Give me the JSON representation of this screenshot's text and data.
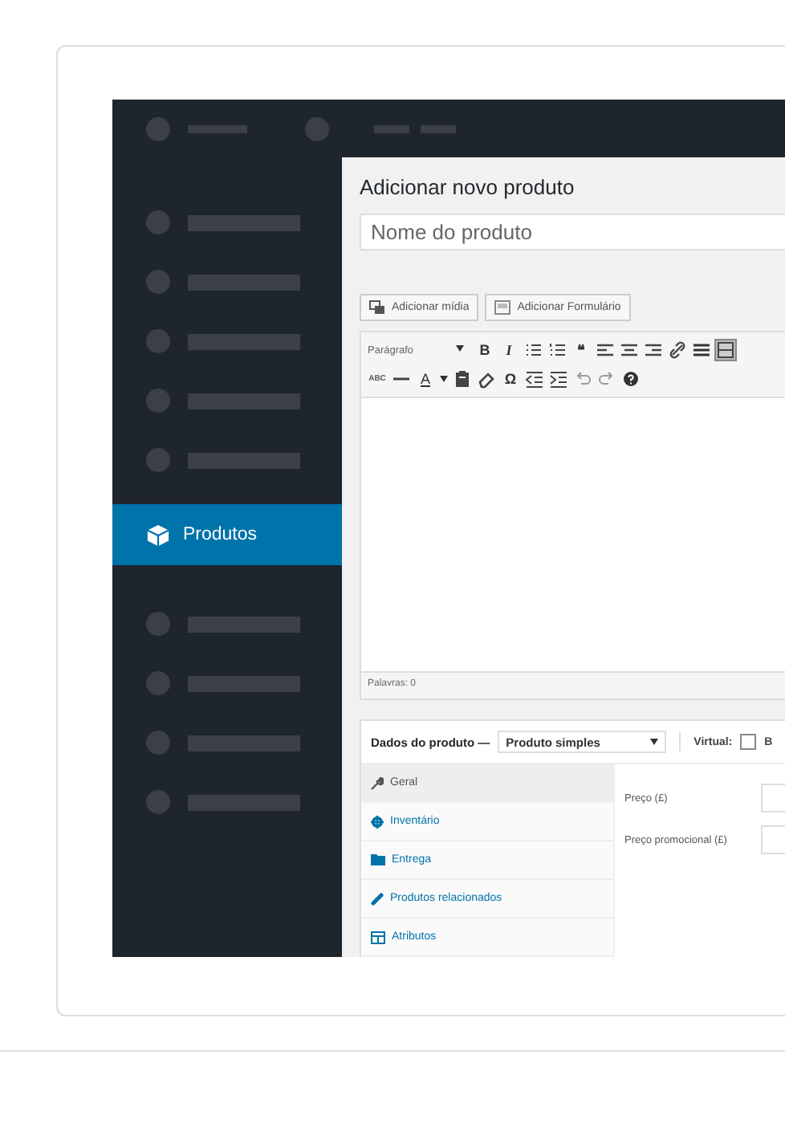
{
  "sidebar": {
    "items": [
      {
        "kind": "placeholder",
        "selected": false
      },
      {
        "kind": "placeholder",
        "selected": false
      },
      {
        "kind": "placeholder",
        "selected": false
      },
      {
        "kind": "placeholder",
        "selected": false
      },
      {
        "kind": "placeholder",
        "selected": false
      },
      {
        "kind": "link",
        "label": "Produtos",
        "selected": true
      },
      {
        "kind": "placeholder",
        "selected": false
      },
      {
        "kind": "placeholder",
        "selected": false
      },
      {
        "kind": "placeholder",
        "selected": false
      },
      {
        "kind": "placeholder",
        "selected": false
      }
    ]
  },
  "page": {
    "title": "Adicionar novo produto",
    "name_field": {
      "placeholder": "Nome do produto"
    }
  },
  "media_buttons": [
    {
      "kind": "media",
      "label": "Adicionar mídia"
    },
    {
      "kind": "form",
      "label": "Adicionar Formulário"
    }
  ],
  "editor": {
    "format_select": "Parágrafo",
    "toolbar_row_1": [
      {
        "kind": "bold",
        "text": "B",
        "selected": false
      },
      {
        "kind": "italic",
        "text": "I",
        "selected": false
      },
      {
        "kind": "bullet-list",
        "selected": false
      },
      {
        "kind": "numbered-list",
        "selected": false
      },
      {
        "kind": "quote",
        "text": "❝",
        "selected": false
      },
      {
        "kind": "align-left",
        "selected": false
      },
      {
        "kind": "align-center",
        "selected": false
      },
      {
        "kind": "align-right",
        "selected": false
      },
      {
        "kind": "link",
        "selected": false
      },
      {
        "kind": "more",
        "selected": false
      },
      {
        "kind": "toolbar",
        "selected": true
      }
    ],
    "toolbar_row_2": [
      {
        "kind": "strikethrough",
        "text": "ABC"
      },
      {
        "kind": "rule"
      },
      {
        "kind": "text-color",
        "text": "A"
      },
      {
        "kind": "clipboard"
      },
      {
        "kind": "eraser"
      },
      {
        "kind": "symbol",
        "text": "Ω"
      },
      {
        "kind": "outdent"
      },
      {
        "kind": "indent"
      },
      {
        "kind": "undo"
      },
      {
        "kind": "redo"
      },
      {
        "kind": "help"
      }
    ],
    "status": "Palavras: 0"
  },
  "product_data": {
    "title": "Dados do produto —",
    "type_select": "Produto simples",
    "virtual_label": "Virtual:",
    "virtual_checked": false,
    "cut_label": "B",
    "tabs": [
      {
        "kind": "wrench",
        "label": "Geral",
        "selected": true
      },
      {
        "kind": "gear",
        "label": "Inventário",
        "selected": false
      },
      {
        "kind": "truck",
        "label": "Entrega",
        "selected": false
      },
      {
        "kind": "link",
        "label": "Produtos relacionados",
        "selected": false
      },
      {
        "kind": "table",
        "label": "Atributos",
        "selected": false
      }
    ],
    "fields": [
      {
        "label": "Preço (£)"
      },
      {
        "label": "Preço promocional (£)"
      }
    ]
  }
}
